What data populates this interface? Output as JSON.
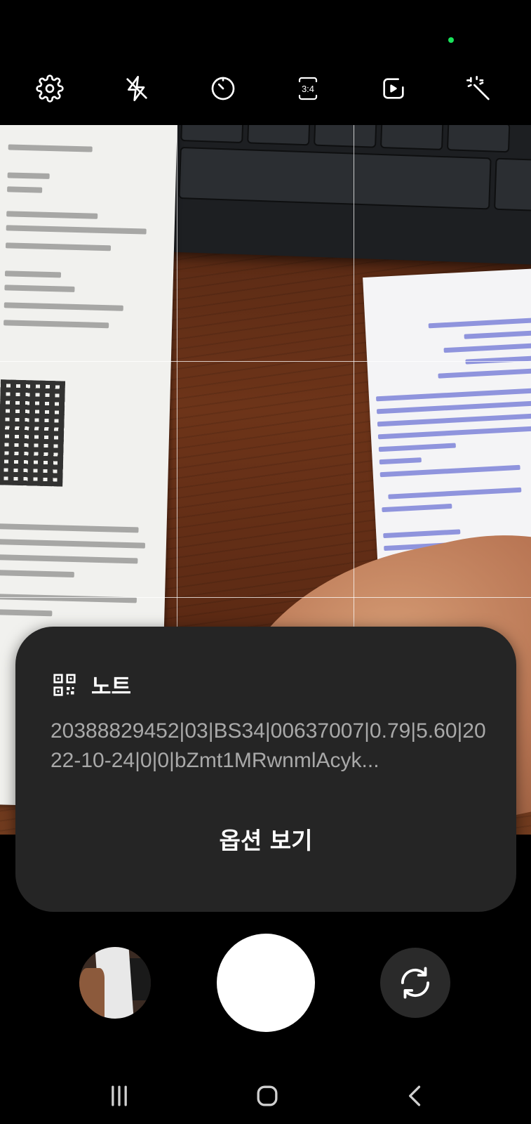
{
  "top_toolbar": {
    "settings_icon": "gear-icon",
    "flash_icon": "flash-off-icon",
    "timer_icon": "timer-icon",
    "ratio_label": "3:4",
    "motion_photo_icon": "motion-photo-icon",
    "filters_icon": "magic-wand-icon"
  },
  "qr_card": {
    "icon": "qr-code-icon",
    "title": "노트",
    "content": "20388829452|03|BS34|00637007|0.79|5.60|2022-10-24|0|0|bZmt1MRwnmlAcyk...",
    "action_label": "옵션 보기"
  },
  "bottom_controls": {
    "gallery_icon": "gallery-thumbnail",
    "shutter_icon": "shutter-button",
    "switch_icon": "switch-camera-icon"
  },
  "navbar": {
    "recents_icon": "recent-apps-icon",
    "home_icon": "home-icon",
    "back_icon": "back-icon"
  },
  "colors": {
    "background": "#000000",
    "card_background": "#252525",
    "card_text": "#a9a9a9",
    "status_dot": "#19e35a"
  }
}
